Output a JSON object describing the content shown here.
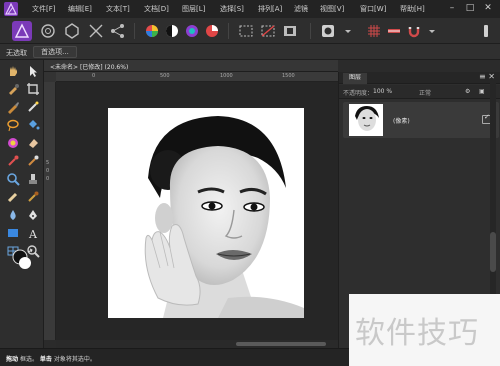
{
  "app": {
    "menus": [
      "文件[F]",
      "编辑[E]",
      "文本[T]",
      "文档[D]",
      "图层[L]",
      "选择[S]",
      "排列[A]",
      "滤镜",
      "视图[V]",
      "窗口[W]",
      "帮助[H]"
    ]
  },
  "context": {
    "selection_label": "无选取",
    "preferences_button": "首选项..."
  },
  "document": {
    "title": "<未命名> [已修改] (20.6%)",
    "ruler_ticks": [
      "0",
      "500",
      "1000",
      "1500"
    ],
    "vertical_ticks": [
      "5",
      "0",
      "0"
    ]
  },
  "layers_panel": {
    "tab": "图层",
    "opacity_label": "不透明度：",
    "opacity_value": "100 %",
    "blend_mode": "正常",
    "layers": [
      {
        "name": "(像素)",
        "visible": true
      }
    ]
  },
  "status": {
    "drag_key": "拖动",
    "drag_text": "框选。",
    "click_key": "单击",
    "click_text": "对象将其选中。"
  },
  "watermark": {
    "text": "软件技巧"
  },
  "colors": {
    "accent": "#7b3ab8",
    "background": "#2b2b2b"
  }
}
